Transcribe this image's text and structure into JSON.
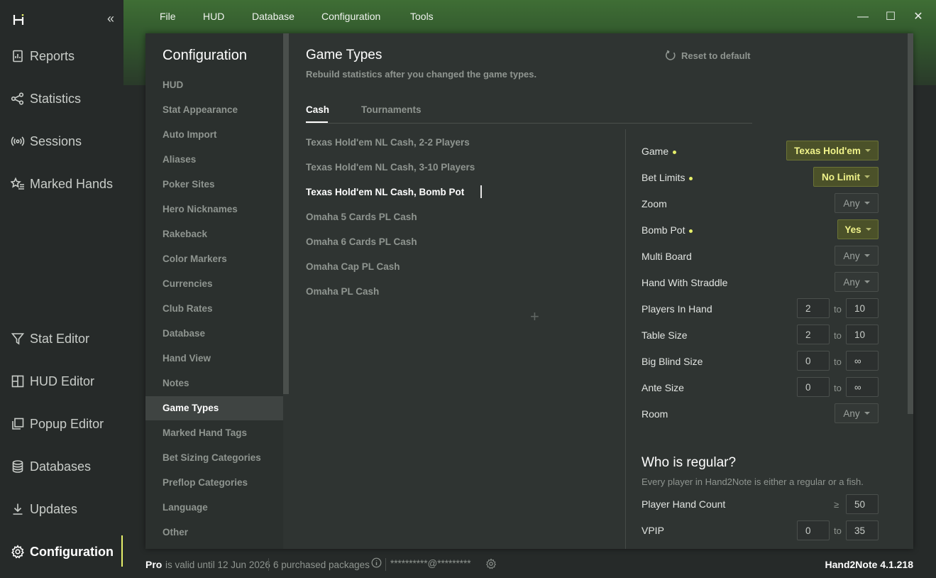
{
  "app_nav": {
    "items": [
      {
        "label": "Reports",
        "icon": "report-icon"
      },
      {
        "label": "Statistics",
        "icon": "share-nodes-icon"
      },
      {
        "label": "Sessions",
        "icon": "broadcast-icon"
      },
      {
        "label": "Marked Hands",
        "icon": "star-list-icon"
      },
      {
        "label": "Stat Editor",
        "icon": "filter-icon"
      },
      {
        "label": "HUD Editor",
        "icon": "layout-icon"
      },
      {
        "label": "Popup Editor",
        "icon": "popup-icon"
      },
      {
        "label": "Databases",
        "icon": "database-icon"
      },
      {
        "label": "Updates",
        "icon": "download-icon"
      },
      {
        "label": "Configuration",
        "icon": "gear-icon"
      }
    ],
    "collapse_glyph": "«"
  },
  "menu": {
    "file": "File",
    "hud": "HUD",
    "database": "Database",
    "configuration": "Configuration",
    "tools": "Tools"
  },
  "window": {
    "minimize": "—",
    "maximize": "☐",
    "close": "✕"
  },
  "config_nav": {
    "title": "Configuration",
    "items": [
      "HUD",
      "Stat Appearance",
      "Auto Import",
      "Aliases",
      "Poker Sites",
      "Hero Nicknames",
      "Rakeback",
      "Color Markers",
      "Currencies",
      "Club Rates",
      "Database",
      "Hand View",
      "Notes",
      "Game Types",
      "Marked Hand Tags",
      "Bet Sizing Categories",
      "Preflop Categories",
      "Language",
      "Other"
    ]
  },
  "game_types": {
    "title": "Game Types",
    "subtitle": "Rebuild statistics after you changed the game types.",
    "reset_label": "Reset to default",
    "tabs": {
      "cash": "Cash",
      "tournaments": "Tournaments"
    },
    "list": [
      "Texas Hold'em NL Cash, 2-2 Players",
      "Texas Hold'em NL Cash, 3-10 Players",
      "Texas Hold'em NL Cash, Bomb Pot",
      "Omaha 5 Cards PL Cash",
      "Omaha 6 Cards PL Cash",
      "Omaha Cap PL Cash",
      "Omaha PL Cash"
    ],
    "add_glyph": "+"
  },
  "fields": {
    "game": {
      "label": "Game",
      "value": "Texas Hold'em"
    },
    "bet_limits": {
      "label": "Bet Limits",
      "value": "No Limit"
    },
    "zoom": {
      "label": "Zoom",
      "value": "Any"
    },
    "bomb_pot": {
      "label": "Bomb Pot",
      "value": "Yes"
    },
    "multi_board": {
      "label": "Multi Board",
      "value": "Any"
    },
    "hand_with_straddle": {
      "label": "Hand With Straddle",
      "value": "Any"
    },
    "players_in_hand": {
      "label": "Players In Hand",
      "from": "2",
      "to": "10"
    },
    "table_size": {
      "label": "Table Size",
      "from": "2",
      "to": "10"
    },
    "big_blind_size": {
      "label": "Big Blind Size",
      "from": "0",
      "to": "∞"
    },
    "ante_size": {
      "label": "Ante Size",
      "from": "0",
      "to": "∞"
    },
    "room": {
      "label": "Room",
      "value": "Any"
    },
    "to_word": "to"
  },
  "regular": {
    "title": "Who is regular?",
    "subtitle": "Every player in Hand2Note is either a regular or a fish.",
    "player_hand_count": {
      "label": "Player Hand Count",
      "op": "≥",
      "value": "50"
    },
    "vpip": {
      "label": "VPIP",
      "from": "0",
      "to": "35"
    }
  },
  "status": {
    "pro": "Pro",
    "valid": "is valid until 12 Jun 2026",
    "packages": "6 purchased packages",
    "email": "**********@*********",
    "version": "Hand2Note 4.1.218"
  },
  "colors": {
    "accent": "#e6ef6a",
    "highlight_bg": "#4b5129",
    "brand_green": "#3f6e35"
  }
}
